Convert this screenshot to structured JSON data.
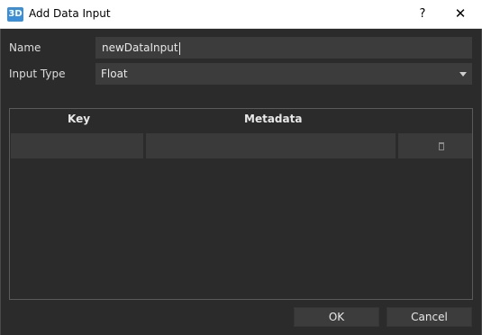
{
  "window": {
    "app_icon_text": "3D",
    "title": "Add Data Input",
    "help_label": "?",
    "close_label": "✕"
  },
  "form": {
    "name_label": "Name",
    "name_value": "newDataInput",
    "type_label": "Input Type",
    "type_value": "Float"
  },
  "table": {
    "columns": [
      "Key",
      "Metadata"
    ],
    "rows": [
      {
        "key": "",
        "metadata": ""
      }
    ]
  },
  "buttons": {
    "ok": "OK",
    "cancel": "Cancel"
  },
  "icons": [
    "app-icon",
    "help-icon",
    "close-icon",
    "dropdown-arrow-icon",
    "trash-icon"
  ],
  "colors": {
    "background": "#2b2b2b",
    "field": "#3c3c3c",
    "titlebar": "#ffffff",
    "accent": "#3a8fd6"
  }
}
